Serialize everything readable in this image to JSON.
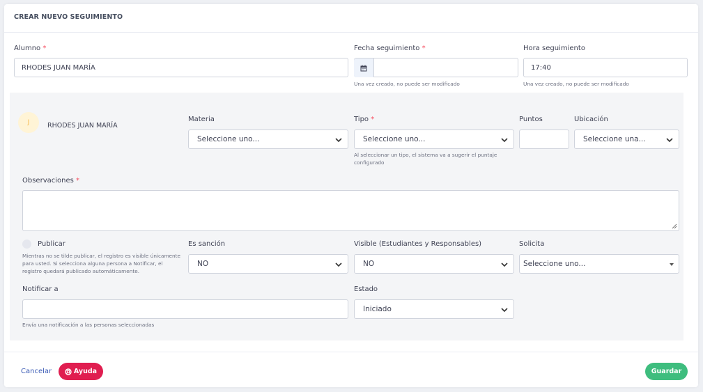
{
  "header": {
    "title": "CREAR NUEVO SEGUIMIENTO"
  },
  "alumno": {
    "label": "Alumno",
    "required": "*",
    "value": "RHODES JUAN MARÍA"
  },
  "fecha": {
    "label": "Fecha seguimiento",
    "required": "*",
    "value": "",
    "help": "Una vez creado, no puede ser modificado"
  },
  "hora": {
    "label": "Hora seguimiento",
    "value": "17:40",
    "help": "Una vez creado, no puede ser modificado"
  },
  "student": {
    "initial": "J",
    "name": "RHODES JUAN MARÍA"
  },
  "materia": {
    "label": "Materia",
    "value": "Seleccione uno..."
  },
  "tipo": {
    "label": "Tipo",
    "required": "*",
    "value": "Seleccione uno...",
    "help": "Al seleccionar un tipo, el sistema va a sugerir el puntaje configurado"
  },
  "puntos": {
    "label": "Puntos",
    "value": ""
  },
  "ubicacion": {
    "label": "Ubicación",
    "value": "Seleccione una..."
  },
  "observaciones": {
    "label": "Observaciones",
    "required": "*",
    "value": ""
  },
  "publicar": {
    "label": "Publicar",
    "help": "Mientras no se tilde publicar, el registro es visible únicamente para usted. Si selecciona alguna persona a Notificar, el registro quedará publicado automáticamente."
  },
  "sancion": {
    "label": "Es sanción",
    "value": "NO"
  },
  "visible": {
    "label": "Visible (Estudiantes y Responsables)",
    "value": "NO"
  },
  "solicita": {
    "label": "Solicita",
    "value": "Seleccione uno..."
  },
  "notificar": {
    "label": "Notificar a",
    "value": "",
    "help": "Envía una notificación a las personas seleccionadas"
  },
  "estado": {
    "label": "Estado",
    "value": "Iniciado"
  },
  "footer": {
    "cancel": "Cancelar",
    "help": "Ayuda",
    "save": "Guardar"
  },
  "colors": {
    "help_button": "#e01e50",
    "save_button": "#3ebd7e",
    "required": "#f64e60",
    "panel_bg": "#f4f5f7"
  }
}
